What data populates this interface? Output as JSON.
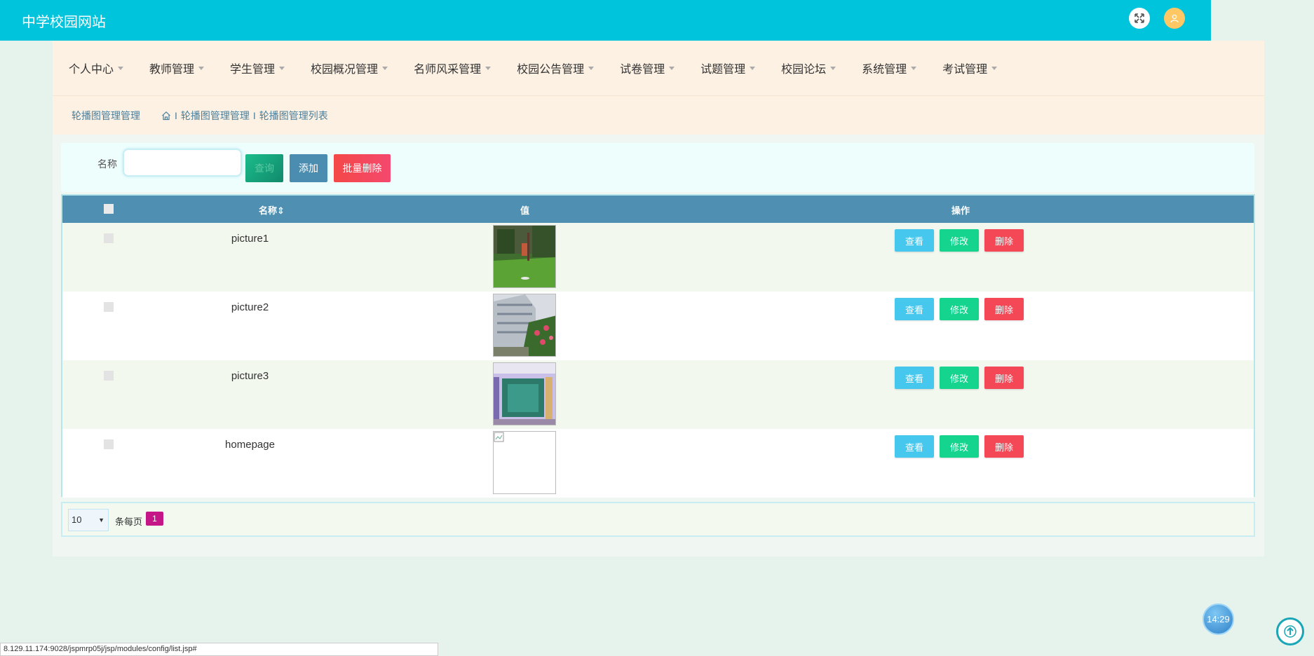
{
  "header": {
    "site_title": "中学校园网站",
    "fullscreen_icon": "expand-arrows-icon",
    "avatar_icon": "user-icon"
  },
  "nav": {
    "items": [
      {
        "label": "个人中心"
      },
      {
        "label": "教师管理"
      },
      {
        "label": "学生管理"
      },
      {
        "label": "校园概况管理"
      },
      {
        "label": "名师风采管理"
      },
      {
        "label": "校园公告管理"
      },
      {
        "label": "试卷管理"
      },
      {
        "label": "试题管理"
      },
      {
        "label": "校园论坛"
      },
      {
        "label": "系统管理"
      },
      {
        "label": "考试管理"
      }
    ]
  },
  "breadcrumb": {
    "title": "轮播图管理管理",
    "home_icon": "home-icon",
    "sep": "I",
    "trail_1": "轮播图管理管理",
    "trail_2": "轮播图管理列表"
  },
  "search": {
    "label": "名称",
    "value": "",
    "query_label": "查询",
    "add_label": "添加",
    "batch_delete_label": "批量删除"
  },
  "table": {
    "headers": {
      "name": "名称⇕",
      "value": "值",
      "actions": "操作"
    },
    "rows": [
      {
        "name": "picture1",
        "image": "grass-campus"
      },
      {
        "name": "picture2",
        "image": "building-flowers"
      },
      {
        "name": "picture3",
        "image": "classroom-door"
      },
      {
        "name": "homepage",
        "image": "broken-image"
      }
    ],
    "view_label": "查看",
    "edit_label": "修改",
    "delete_label": "删除"
  },
  "pager": {
    "page_size": "10",
    "per_page_label": "条每页",
    "current_page": "1"
  },
  "status_bar": {
    "url": "8.129.11.174:9028/jspmrp05j/jsp/modules/config/list.jsp#"
  },
  "clock": {
    "time": "14:29"
  },
  "colors": {
    "topbar": "#00c3dc",
    "table_header": "#4f90b2",
    "danger": "#f54857",
    "success": "#14d48e",
    "info": "#46c8ee"
  }
}
